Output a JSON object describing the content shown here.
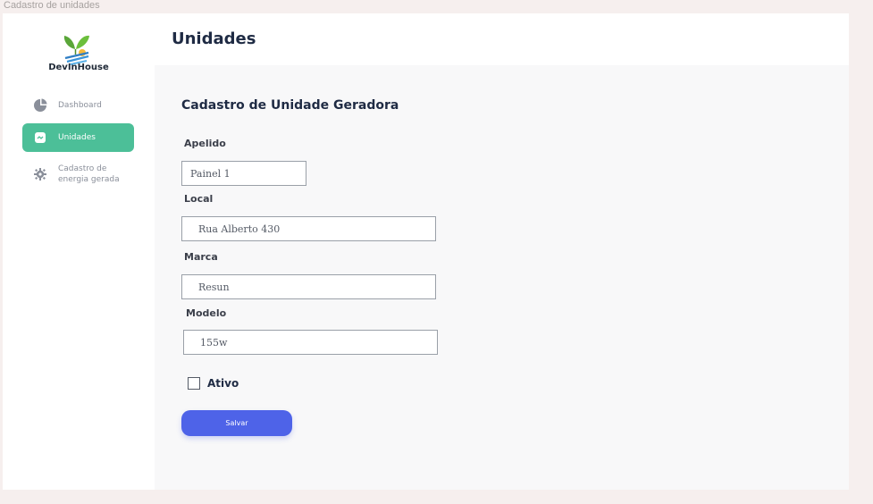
{
  "frame_title": "Cadastro de unidades",
  "brand": {
    "name": "DevInHouse"
  },
  "sidebar": {
    "items": [
      {
        "label": "Dashboard",
        "icon": "pie-chart-icon",
        "active": false
      },
      {
        "label": "Unidades",
        "icon": "unit-card-icon",
        "active": true
      },
      {
        "label": "Cadastro de energia gerada",
        "icon": "gear-icon",
        "active": false
      }
    ]
  },
  "header": {
    "title": "Unidades"
  },
  "form": {
    "title": "Cadastro de Unidade Geradora",
    "fields": {
      "apelido": {
        "label": "Apelido",
        "value": "Painel 1"
      },
      "local": {
        "label": "Local",
        "value": "Rua Alberto 430"
      },
      "marca": {
        "label": "Marca",
        "value": "Resun"
      },
      "modelo": {
        "label": "Modelo",
        "value": "155w"
      }
    },
    "ativo": {
      "label": "Ativo",
      "checked": false
    },
    "submit_label": "Salvar"
  },
  "colors": {
    "accent": "#4cbf98",
    "primary_button": "#4e63e8",
    "heading": "#1f2b44"
  }
}
